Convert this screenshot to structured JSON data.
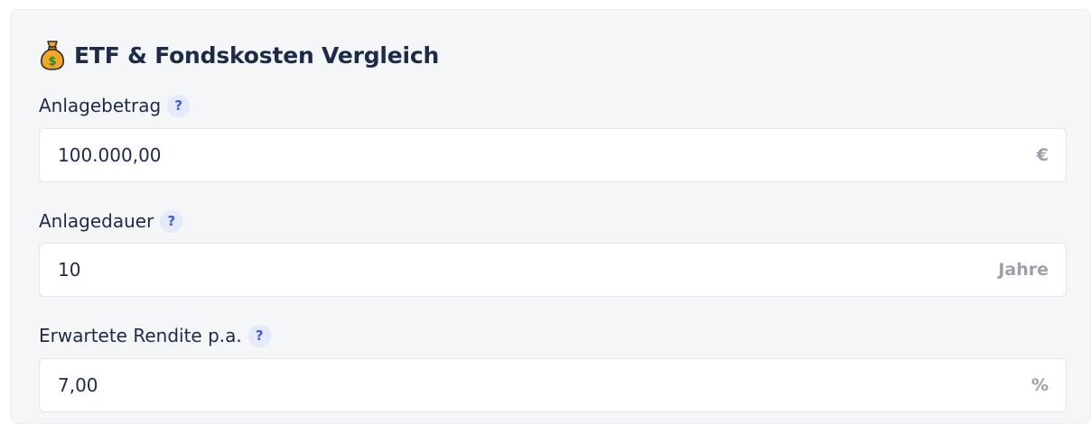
{
  "card": {
    "title": "ETF & Fondskosten Vergleich",
    "title_icon": "money-bag-icon"
  },
  "fields": [
    {
      "label": "Anlagebetrag",
      "help": "?",
      "value": "100.000,00",
      "unit": "€"
    },
    {
      "label": "Anlagedauer",
      "help": "?",
      "value": "10",
      "unit": "Jahre"
    },
    {
      "label": "Erwartete Rendite p.a.",
      "help": "?",
      "value": "7,00",
      "unit": "%"
    }
  ],
  "colors": {
    "card_background": "#f5f6f8",
    "text": "#1e2a4a",
    "help_badge_bg": "#e4e9fb",
    "help_badge_fg": "#3b5bdb",
    "unit_text": "#9aa0ad",
    "money_bag": "#f4a623"
  }
}
